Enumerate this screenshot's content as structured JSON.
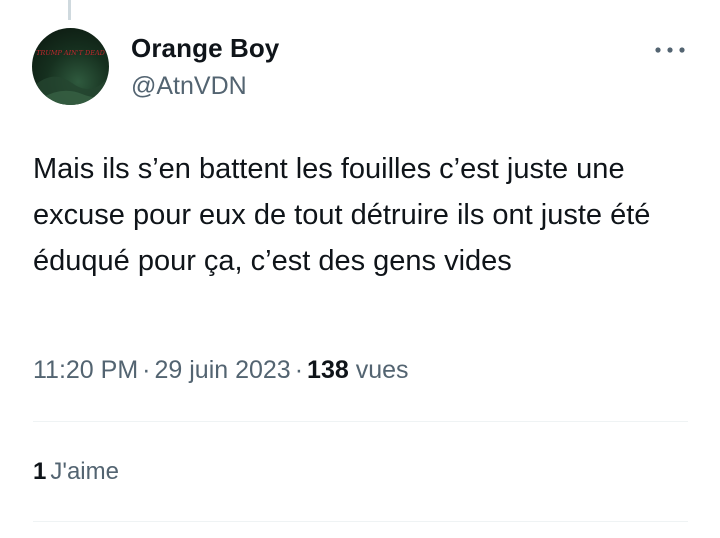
{
  "author": {
    "display_name": "Orange Boy",
    "handle": "@AtnVDN",
    "avatar_text": "TRUMP AIN'T DEAD"
  },
  "tweet": {
    "text": "Mais ils s’en battent les fouilles c’est juste une excuse pour eux de tout détruire ils ont juste été éduqué pour ça, c’est des gens vides",
    "time": "11:20 PM",
    "separator": "·",
    "date": "29 juin 2023",
    "views_count": "138",
    "views_label": "vues"
  },
  "stats": {
    "likes_count": "1",
    "likes_label": "J'aime"
  },
  "icons": {
    "more": "more-horizontal-icon"
  },
  "colors": {
    "text_primary": "#0f1419",
    "text_secondary": "#536471",
    "divider": "#eff3f4",
    "avatar_text": "#c0282d"
  }
}
